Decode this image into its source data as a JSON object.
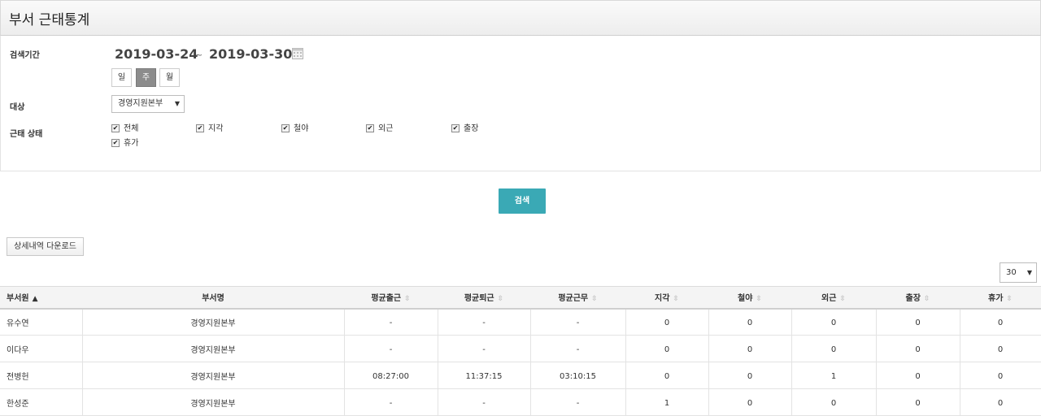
{
  "header": {
    "title": "부서 근태통계"
  },
  "form": {
    "period_label": "검색기간",
    "date_start": "2019-03-24",
    "date_sep": "~",
    "date_end": "2019-03-30",
    "period_buttons": [
      "일",
      "주",
      "월"
    ],
    "period_selected": "주",
    "target_label": "대상",
    "target_value": "경영지원본부",
    "status_label": "근태 상태",
    "status_options": [
      "전체",
      "지각",
      "철야",
      "외근",
      "출장",
      "휴가"
    ]
  },
  "actions": {
    "search_label": "검색",
    "download_label": "상세내역 다운로드"
  },
  "page_size": "30",
  "table": {
    "headers": [
      "부서원",
      "부서명",
      "평균출근",
      "평균퇴근",
      "평균근무",
      "지각",
      "철야",
      "외근",
      "출장",
      "휴가"
    ],
    "rows": [
      [
        "유수연",
        "경영지원본부",
        "-",
        "-",
        "-",
        "0",
        "0",
        "0",
        "0",
        "0"
      ],
      [
        "이다우",
        "경영지원본부",
        "-",
        "-",
        "-",
        "0",
        "0",
        "0",
        "0",
        "0"
      ],
      [
        "전병헌",
        "경영지원본부",
        "08:27:00",
        "11:37:15",
        "03:10:15",
        "0",
        "0",
        "1",
        "0",
        "0"
      ],
      [
        "한성준",
        "경영지원본부",
        "-",
        "-",
        "-",
        "1",
        "0",
        "0",
        "0",
        "0"
      ]
    ]
  },
  "icons": {
    "calendar": "calendar-icon",
    "sort": "sort-icon",
    "checkbox": "checkmark-icon",
    "dropdown": "triangle-down-icon"
  },
  "colors": {
    "accent": "#3aa9b5",
    "active_period": "#8c8c8c"
  }
}
